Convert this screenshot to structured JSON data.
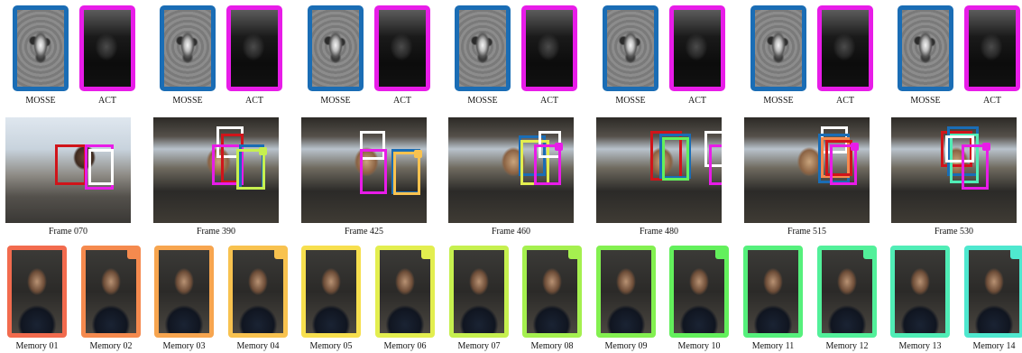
{
  "templates": [
    {
      "mosse": "MOSSE",
      "act": "ACT"
    },
    {
      "mosse": "MOSSE",
      "act": "ACT"
    },
    {
      "mosse": "MOSSE",
      "act": "ACT"
    },
    {
      "mosse": "MOSSE",
      "act": "ACT"
    },
    {
      "mosse": "MOSSE",
      "act": "ACT"
    },
    {
      "mosse": "MOSSE",
      "act": "ACT"
    },
    {
      "mosse": "MOSSE",
      "act": "ACT"
    }
  ],
  "frames": [
    {
      "label": "Frame 070"
    },
    {
      "label": "Frame 390"
    },
    {
      "label": "Frame 425"
    },
    {
      "label": "Frame 460"
    },
    {
      "label": "Frame 480"
    },
    {
      "label": "Frame 515"
    },
    {
      "label": "Frame 530"
    }
  ],
  "memories": [
    {
      "label": "Memory 01",
      "color": "#f26b4e"
    },
    {
      "label": "Memory 02",
      "color": "#f58a4e"
    },
    {
      "label": "Memory 03",
      "color": "#f7a54f"
    },
    {
      "label": "Memory 04",
      "color": "#f8c24f"
    },
    {
      "label": "Memory 05",
      "color": "#f7df4e"
    },
    {
      "label": "Memory 06",
      "color": "#e3ee4f"
    },
    {
      "label": "Memory 07",
      "color": "#c6f04f"
    },
    {
      "label": "Memory 08",
      "color": "#a5f04f"
    },
    {
      "label": "Memory 09",
      "color": "#83f050"
    },
    {
      "label": "Memory 10",
      "color": "#63f05c"
    },
    {
      "label": "Memory 11",
      "color": "#55f07c"
    },
    {
      "label": "Memory 12",
      "color": "#52f09a"
    },
    {
      "label": "Memory 13",
      "color": "#50edb6"
    },
    {
      "label": "Memory 14",
      "color": "#4fe8cf"
    }
  ],
  "colors": {
    "mosse_border": "#1a6db5",
    "act_border": "#e81ce8",
    "box_red": "#d0141a",
    "box_white": "#ffffff",
    "box_blue": "#1a6db5",
    "box_magenta": "#e81ce8"
  }
}
